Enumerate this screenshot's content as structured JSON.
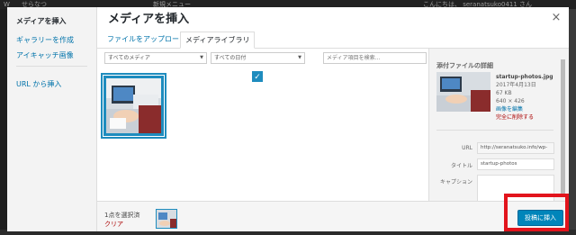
{
  "admin_bar": {
    "site_label": "せらなつ",
    "new_label": "新規メニュー",
    "greeting": "こんにちは、 seranatsuko0411 さん"
  },
  "modal": {
    "title": "メディアを挿入",
    "close_label": "×",
    "menu": {
      "items": [
        "メディアを挿入",
        "ギャラリーを作成",
        "アイキャッチ画像"
      ],
      "url_insert": "URL から挿入"
    },
    "tabs": [
      "ファイルをアップロード",
      "メディアライブラリ"
    ],
    "filters": {
      "type": "すべてのメディア",
      "date": "すべての日付"
    },
    "search_placeholder": "メディア項目を検索...",
    "details": {
      "heading": "添付ファイルの詳細",
      "filename": "startup-photos.jpg",
      "date": "2017年4月13日",
      "size": "67 KB",
      "dimensions": "640 × 426",
      "edit_link": "画像を編集",
      "delete_link": "完全に削除する",
      "url_label": "URL",
      "url_value": "http://seranatsuko.info/wp-",
      "title_label": "タイトル",
      "title_value": "startup-photos",
      "caption_label": "キャプション",
      "caption_value": ""
    },
    "footer": {
      "selected_count": "1点を選択済",
      "clear_label": "クリア",
      "insert_button": "投稿に挿入"
    }
  },
  "colors": {
    "accent": "#0073aa",
    "primary_button": "#0085ba",
    "selection_border": "#1e8cbe",
    "highlight_frame": "#e2141c",
    "delete_link": "#aa0000"
  },
  "icons": [
    "close-icon",
    "chevron-down-icon",
    "checkmark-icon"
  ]
}
